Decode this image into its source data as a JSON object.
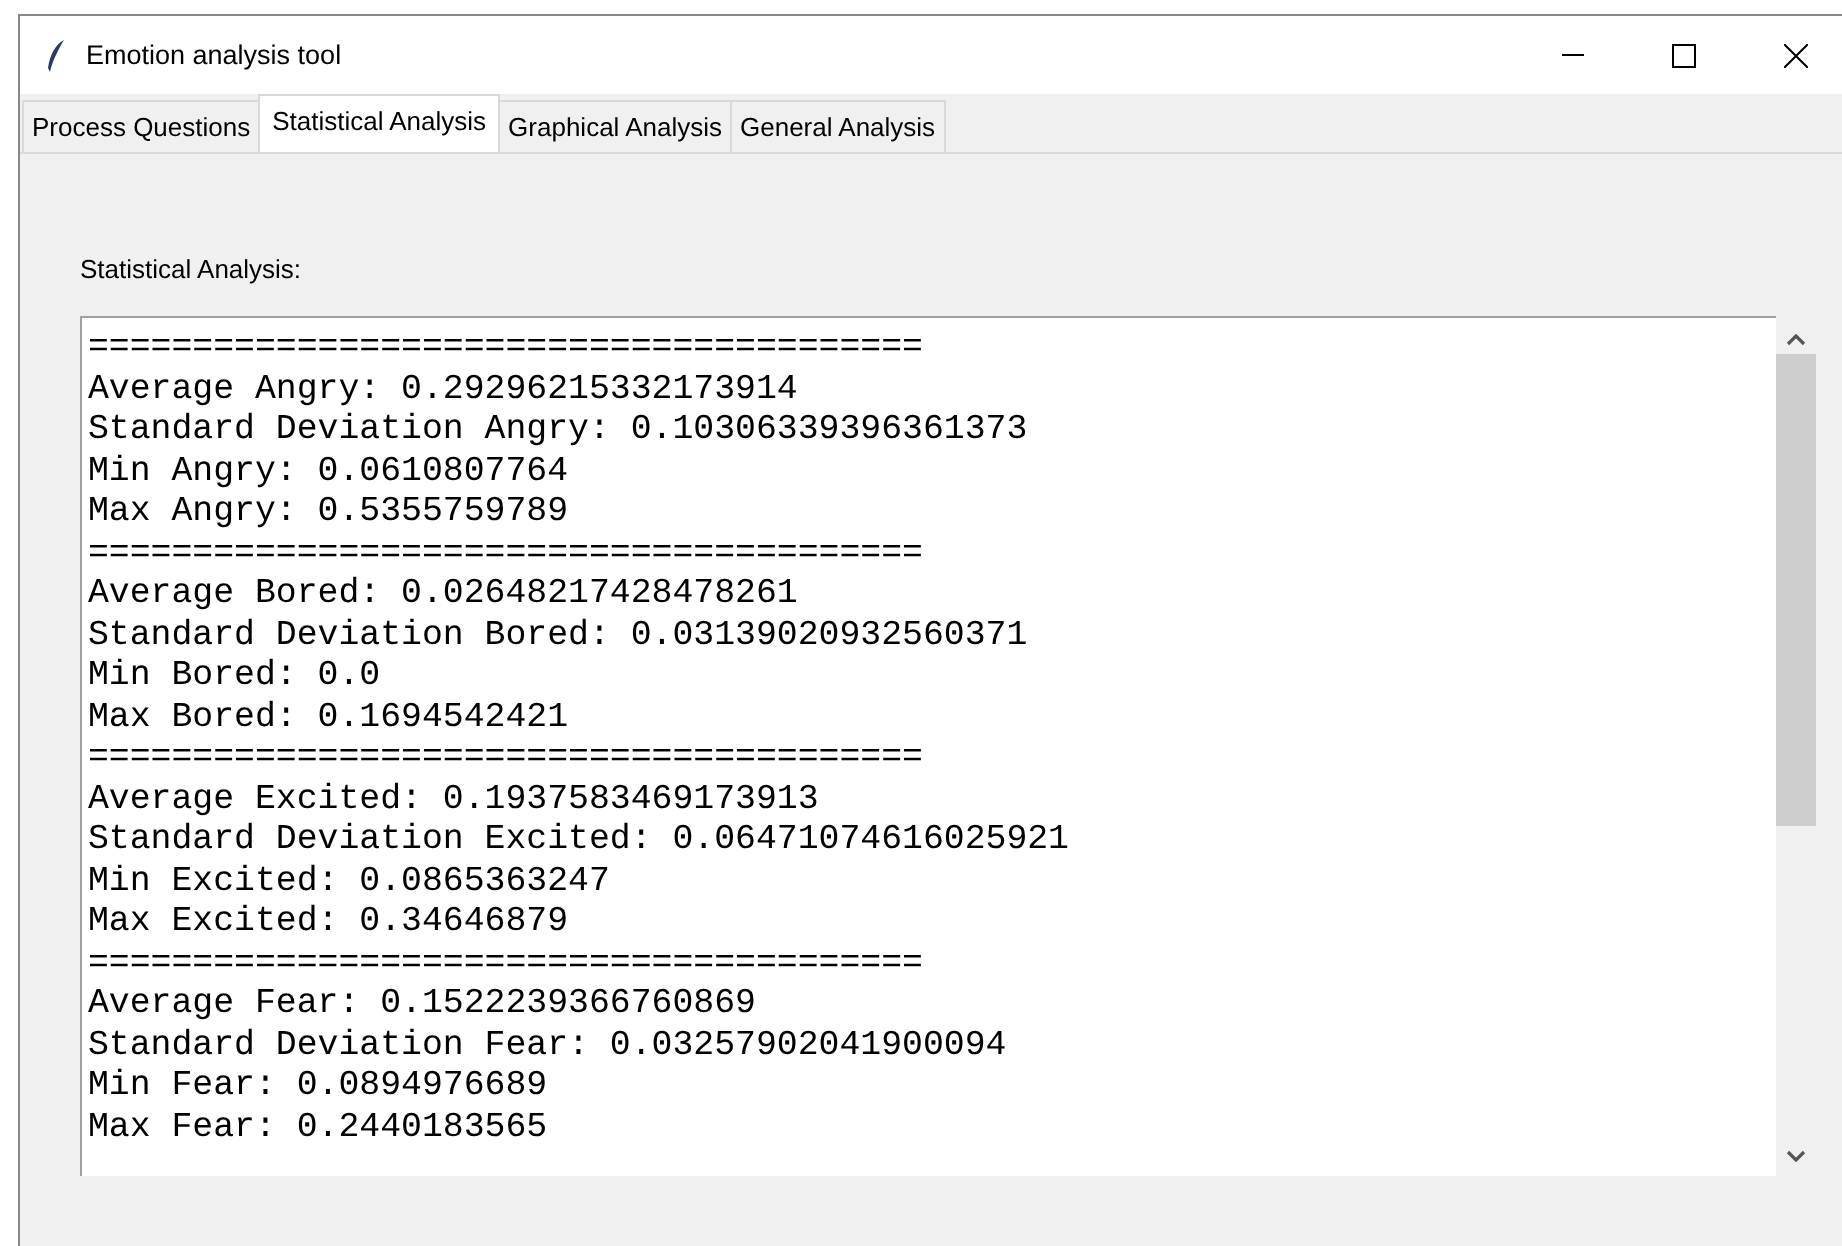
{
  "window": {
    "title": "Emotion analysis tool"
  },
  "tabs": [
    {
      "label": "Process Questions",
      "selected": false
    },
    {
      "label": "Statistical Analysis",
      "selected": true
    },
    {
      "label": "Graphical Analysis",
      "selected": false
    },
    {
      "label": "General Analysis",
      "selected": false
    }
  ],
  "section_label": "Statistical Analysis:",
  "output_lines": [
    "========================================",
    "Average Angry: 0.29296215332173914",
    "Standard Deviation Angry: 0.10306339396361373",
    "Min Angry: 0.0610807764",
    "Max Angry: 0.5355759789",
    "========================================",
    "Average Bored: 0.02648217428478261",
    "Standard Deviation Bored: 0.03139020932560371",
    "Min Bored: 0.0",
    "Max Bored: 0.1694542421",
    "========================================",
    "Average Excited: 0.1937583469173913",
    "Standard Deviation Excited: 0.06471074616025921",
    "Min Excited: 0.0865363247",
    "Max Excited: 0.34646879",
    "========================================",
    "Average Fear: 0.1522239366760869",
    "Standard Deviation Fear: 0.03257902041900094",
    "Min Fear: 0.0894976689",
    "Max Fear: 0.2440183565"
  ]
}
